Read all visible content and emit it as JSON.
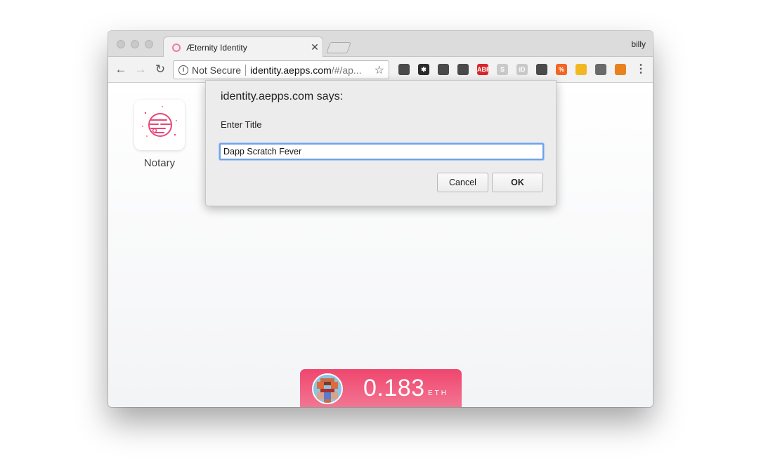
{
  "browser": {
    "tab_title": "Æternity Identity",
    "tab_close": "✕",
    "profile_name": "billy",
    "security_label": "Not Secure",
    "url_host": "identity.aepps.com",
    "url_path": "/#/ap...",
    "extensions": [
      {
        "name": "1password-icon",
        "label": "",
        "color": "#4a4a4a"
      },
      {
        "name": "extension-asterisk-icon",
        "label": "✱",
        "color": "#2b2b2b"
      },
      {
        "name": "pocket-icon",
        "label": "",
        "color": "#4a4a4a"
      },
      {
        "name": "bitwarden-icon",
        "label": "",
        "color": "#4a4a4a"
      },
      {
        "name": "adblock-plus-icon",
        "label": "ABP",
        "color": "#d7262b"
      },
      {
        "name": "skype-icon",
        "label": "S",
        "color": "#c9c9c9"
      },
      {
        "name": "identity-id-icon",
        "label": "iD",
        "color": "#c9c9c9"
      },
      {
        "name": "evernote-icon",
        "label": "",
        "color": "#4a4a4a"
      },
      {
        "name": "percent-icon",
        "label": "%",
        "color": "#f26522"
      },
      {
        "name": "notes-icon",
        "label": "",
        "color": "#f2b824"
      },
      {
        "name": "ghost-icon",
        "label": "",
        "color": "#6a6a6a"
      },
      {
        "name": "metamask-fox-icon",
        "label": "",
        "color": "#e8821e"
      }
    ]
  },
  "page": {
    "app_label": "Notary",
    "balance_value": "0.183",
    "balance_unit": "ETH"
  },
  "dialog": {
    "title": "identity.aepps.com says:",
    "message": "Enter Title",
    "input_value": "Dapp Scratch Fever",
    "cancel_label": "Cancel",
    "ok_label": "OK"
  }
}
